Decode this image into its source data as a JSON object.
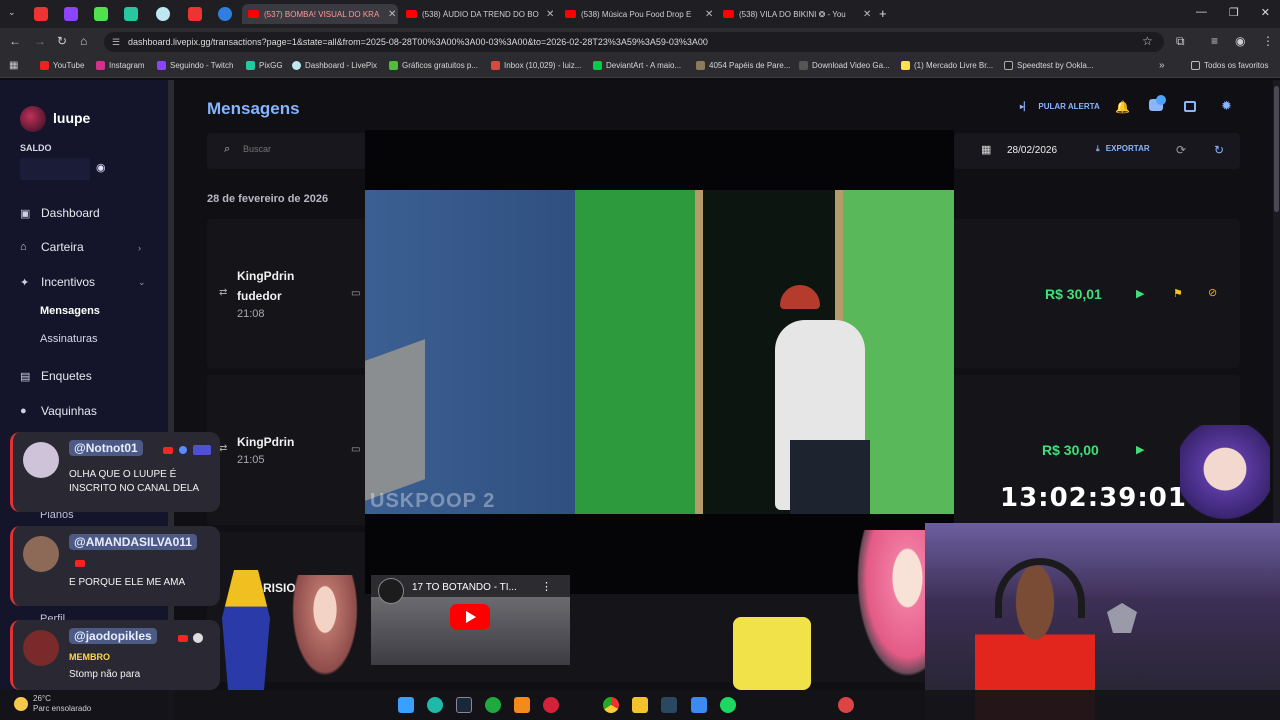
{
  "browser": {
    "tabs": [
      {
        "label": "(537) BOMBA! VISUAL DO KRA",
        "active": true
      },
      {
        "label": "(538) ÁUDIO DA TREND DO BO",
        "active": false
      },
      {
        "label": "(538) Música Pou Food Drop E",
        "active": false
      },
      {
        "label": "(538) VILA DO BIKINI ❂ - You",
        "active": false
      }
    ],
    "url": "dashboard.livepix.gg/transactions?page=1&state=all&from=2025-08-28T00%3A00%3A00-03%3A00&to=2026-02-28T23%3A59%3A59-03%3A00",
    "bookmarks": [
      "YouTube",
      "Instagram",
      "Seguindo - Twitch",
      "PixGG",
      "Dashboard - LivePix",
      "Gráficos gratuitos p...",
      "Inbox (10,029) - luiz...",
      "DeviantArt - A maio...",
      "4054 Papéis de Pare...",
      "Download Video Ga...",
      "(1) Mercado Livre Br...",
      "Speedtest by Ookla..."
    ],
    "all_favorites": "Todos os favoritos"
  },
  "sidebar": {
    "username": "luupe",
    "balance_label": "SALDO",
    "items": {
      "dashboard": "Dashboard",
      "carteira": "Carteira",
      "incentivos": "Incentivos",
      "mensagens": "Mensagens",
      "assinaturas": "Assinaturas",
      "enquetes": "Enquetes",
      "vaquinhas": "Vaquinhas",
      "planos": "Planos",
      "perfil": "Perfil"
    }
  },
  "main": {
    "title": "Mensagens",
    "skip_alert": "PULAR ALERTA",
    "search_placeholder": "Buscar",
    "date_filter": "28/02/2026",
    "export_label": "EXPORTAR",
    "date_group": "28 de fevereiro de 2026",
    "rows": [
      {
        "name_line1": "KingPdrin",
        "name_line2": "fudedor",
        "time": "21:08",
        "amount": "R$ 30,01"
      },
      {
        "name_line1": "KingPdrin",
        "name_line2": "",
        "time": "21:05",
        "amount": "R$ 30,00"
      },
      {
        "name_line1": "RISIO Û",
        "name_line2": "",
        "time": "",
        "amount": ""
      }
    ]
  },
  "overlay": {
    "video_caption": "USKPOOP 2",
    "clock": "13:02:39:01",
    "yt_mini_title": "17 TO BOTANDO - TI..."
  },
  "chat": [
    {
      "user": "@Notnot01",
      "role": "",
      "message": "OLHA QUE O LUUPE É INSCRITO NO CANAL DELA",
      "avatar_color": "#cfc3d9"
    },
    {
      "user": "@AMANDASILVA011",
      "role": "",
      "message": "E PORQUE ELE ME AMA",
      "avatar_color": "#8d6a58"
    },
    {
      "user": "@jaodopikles",
      "role": "MEMBRO",
      "message": "Stomp não para",
      "avatar_color": "#7a2a2a"
    }
  ],
  "taskbar": {
    "weather_temp": "26°C",
    "weather_text": "Parc ensolarado"
  },
  "colors": {
    "accent": "#86b5ff",
    "money": "#3fe07a",
    "sidebar_bg": "#14152a"
  }
}
